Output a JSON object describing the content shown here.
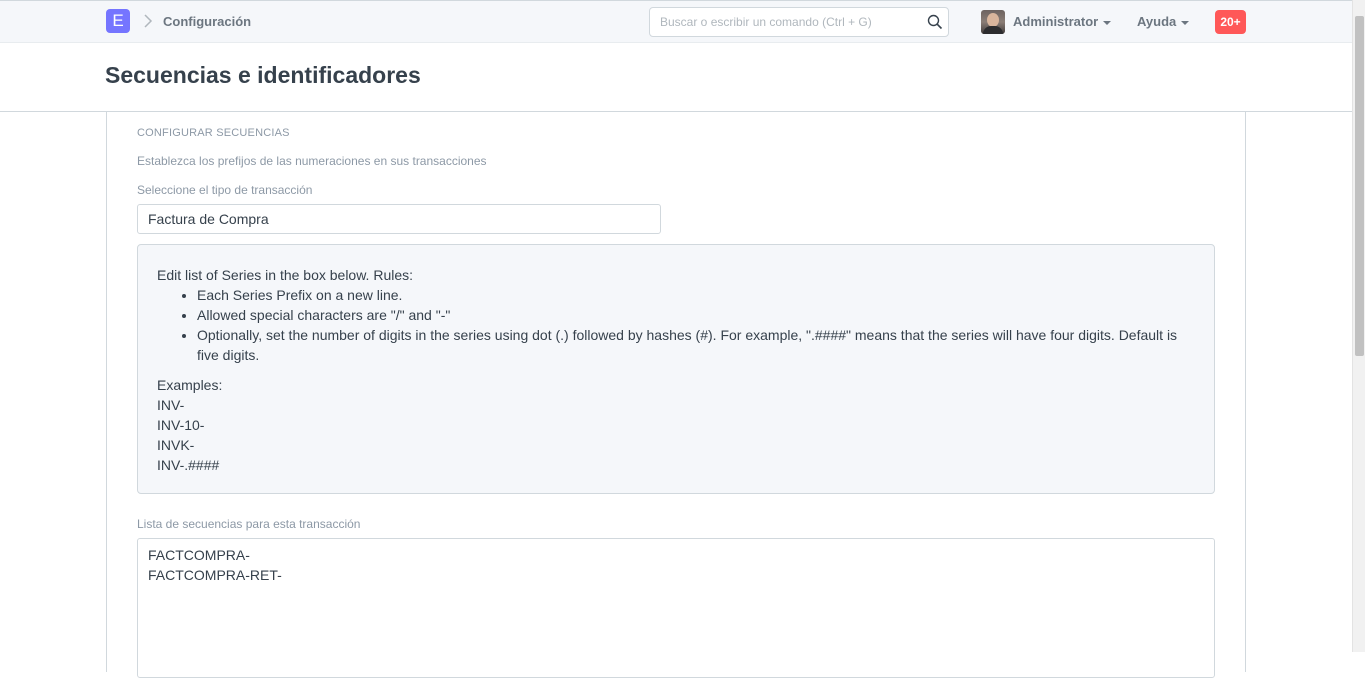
{
  "navbar": {
    "logo_letter": "E",
    "breadcrumb": "Configuración",
    "search_placeholder": "Buscar o escribir un comando (Ctrl + G)",
    "user_label": "Administrator",
    "help_label": "Ayuda",
    "notifications": "20+"
  },
  "page": {
    "title": "Secuencias e identificadores"
  },
  "form": {
    "section_heading": "CONFIGURAR SECUENCIAS",
    "section_description": "Establezca los prefijos de las numeraciones en sus transacciones",
    "transaction_type_label": "Seleccione el tipo de transacción",
    "transaction_type_value": "Factura de Compra",
    "help": {
      "intro": "Edit list of Series in the box below. Rules:",
      "rules": [
        "Each Series Prefix on a new line.",
        "Allowed special characters are \"/\" and \"-\"",
        "Optionally, set the number of digits in the series using dot (.) followed by hashes (#). For example, \".####\" means that the series will have four digits. Default is five digits."
      ],
      "examples_heading": "Examples:",
      "examples": [
        "INV-",
        "INV-10-",
        "INVK-",
        "INV-.####"
      ]
    },
    "series_list_label": "Lista de secuencias para esta transacción",
    "series_list": [
      "FACTCOMPRA-",
      "FACTCOMPRA-RET-"
    ]
  },
  "colors": {
    "logo": "#7575ff",
    "notification_badge": "#ff5858",
    "muted_text": "#8d99a6"
  }
}
